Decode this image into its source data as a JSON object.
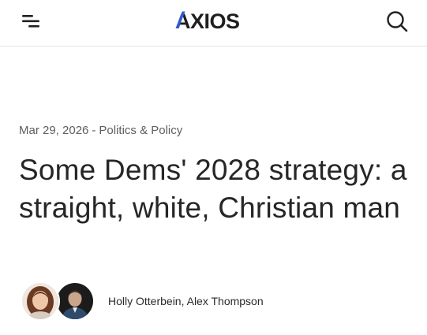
{
  "header": {
    "logo_text": "AXIOS",
    "menu_icon": "menu-icon",
    "search_icon": "search-icon"
  },
  "article": {
    "date": "Mar 29, 2026",
    "separator": "-",
    "category": "Politics & Policy",
    "headline": "Some Dems' 2028 strategy: a straight, white, Christian man",
    "authors": [
      {
        "name": "Holly Otterbein"
      },
      {
        "name": "Alex Thompson"
      }
    ],
    "author_joiner": ", "
  },
  "colors": {
    "logo_dark": "#1f1f1f",
    "logo_accent": "#2f5bd3",
    "meta_text": "#5e5e5e",
    "headline_text": "#262626"
  }
}
